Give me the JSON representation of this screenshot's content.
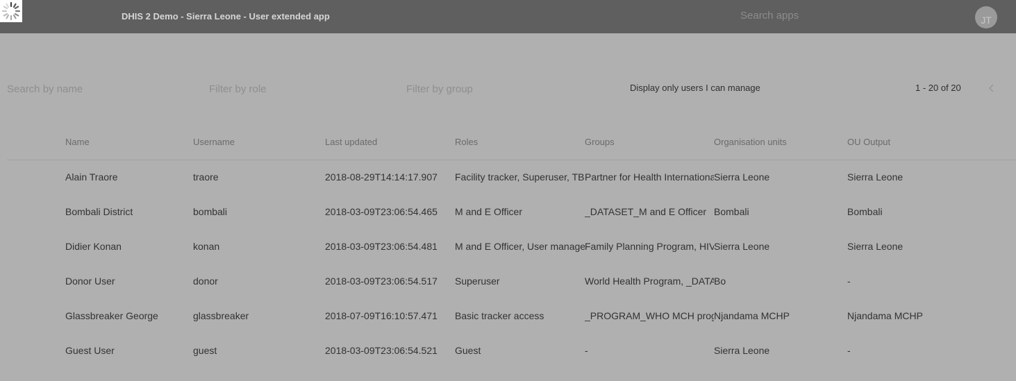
{
  "header": {
    "app_title": "DHIS 2 Demo - Sierra Leone - User extended app",
    "search_placeholder": "Search apps",
    "avatar_initials": "JT"
  },
  "filters": {
    "search_by_name": "Search by name",
    "filter_by_role": "Filter by role",
    "filter_by_group": "Filter by group",
    "manage_toggle_label": "Display only users I can manage"
  },
  "pager": {
    "range": "1 - 20 of 20"
  },
  "table": {
    "columns": [
      "Name",
      "Username",
      "Last updated",
      "Roles",
      "Groups",
      "Organisation units",
      "OU Output"
    ],
    "rows": [
      [
        "Alain Traore",
        "traore",
        "2018-08-29T14:14:17.907",
        "Facility tracker, Superuser, TB program",
        "Partner for Health International",
        "Sierra Leone",
        "Sierra Leone"
      ],
      [
        "Bombali District",
        "bombali",
        "2018-03-09T23:06:54.465",
        "M and E Officer",
        "_DATASET_M and E Officer",
        "Bombali",
        "Bombali"
      ],
      [
        "Didier Konan",
        "konan",
        "2018-03-09T23:06:54.481",
        "M and E Officer, User manager",
        "Family Planning Program, HIV",
        "Sierra Leone",
        "Sierra Leone"
      ],
      [
        "Donor User",
        "donor",
        "2018-03-09T23:06:54.517",
        "Superuser",
        "World Health Program, _DATASET",
        "Bo",
        "-"
      ],
      [
        "Glassbreaker George",
        "glassbreaker",
        "2018-07-09T16:10:57.471",
        "Basic tracker access",
        "_PROGRAM_WHO MCH program",
        "Njandama MCHP",
        "Njandama MCHP"
      ],
      [
        "Guest User",
        "guest",
        "2018-03-09T23:06:54.521",
        "Guest",
        "-",
        "Sierra Leone",
        "-"
      ]
    ]
  }
}
